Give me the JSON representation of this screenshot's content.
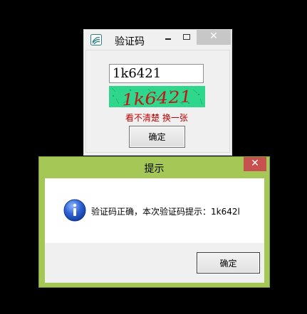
{
  "captcha_window": {
    "title": "验证码",
    "close_symbol": "✕",
    "input_value": "1k6421",
    "captcha_image_text": "1k6421",
    "refresh_link": "看不清楚 换一张",
    "confirm_button": "确定"
  },
  "message_box": {
    "title": "提示",
    "close_symbol": "✕",
    "message": "验证码正确，本次验证码提示：1k642l",
    "ok_button": "确定",
    "icon": "info-icon"
  },
  "colors": {
    "captcha_bg": "#2ed78b",
    "captcha_text": "#c01818",
    "link": "#c00000",
    "dialog_frame": "#a4c755",
    "dialog_close": "#c75050"
  }
}
